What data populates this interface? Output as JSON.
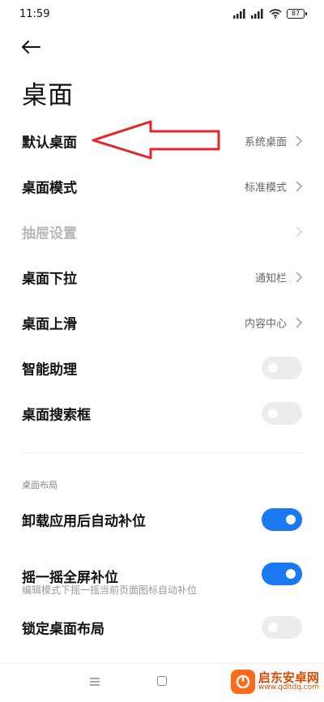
{
  "status_bar": {
    "time": "11:59",
    "battery": "87"
  },
  "page": {
    "title": "桌面"
  },
  "settings": [
    {
      "label": "默认桌面",
      "value": "系统桌面"
    },
    {
      "label": "桌面模式",
      "value": "标准模式"
    },
    {
      "label": "抽屉设置",
      "value": ""
    },
    {
      "label": "桌面下拉",
      "value": "通知栏"
    },
    {
      "label": "桌面上滑",
      "value": "内容中心"
    },
    {
      "label": "智能助理",
      "toggle": false
    },
    {
      "label": "桌面搜索框",
      "toggle": false
    }
  ],
  "layout_section": {
    "header": "桌面布局",
    "items": [
      {
        "label": "卸载应用后自动补位",
        "toggle": true
      },
      {
        "label": "摇一摇全屏补位",
        "subtitle": "编辑模式下摇一摇当前页面图标自动补位",
        "toggle": true
      },
      {
        "label": "锁定桌面布局",
        "toggle": false
      }
    ]
  },
  "colors": {
    "accent": "#1a78f2",
    "annotation_arrow": "#e8232b",
    "toggle_off": "#ececec"
  },
  "watermark": {
    "title": "启东安卓网",
    "url": "www.qdltdq.com"
  }
}
